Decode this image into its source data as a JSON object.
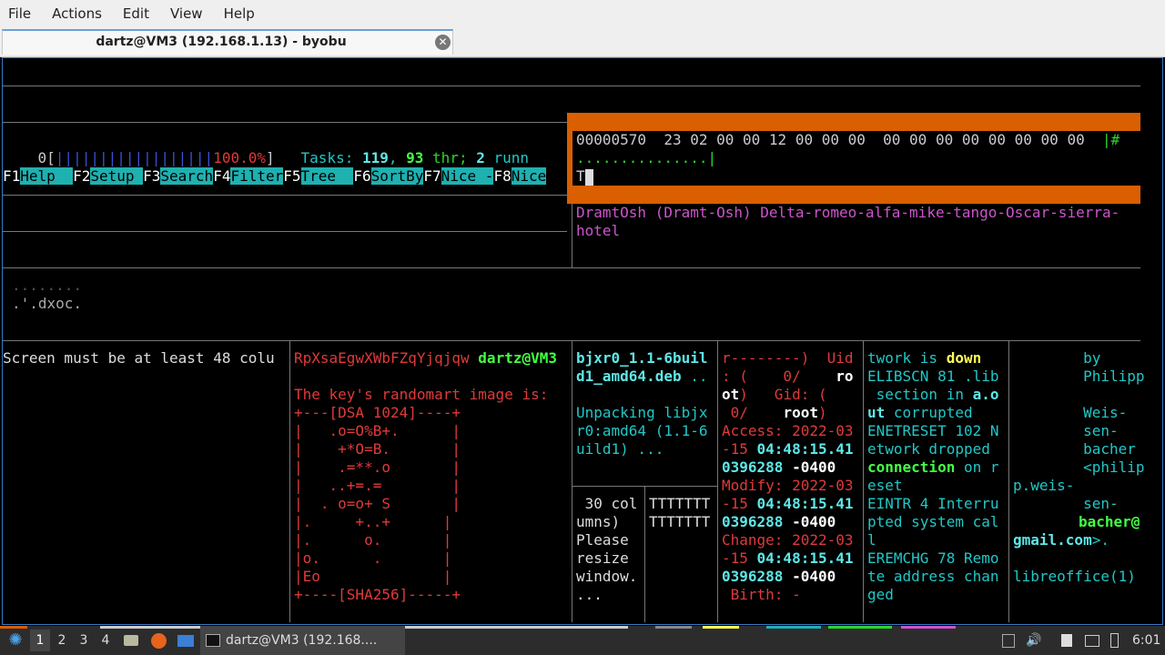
{
  "menubar": {
    "items": [
      "File",
      "Actions",
      "Edit",
      "View",
      "Help"
    ]
  },
  "tab": {
    "title": "dartz@VM3 (192.168.1.13) - byobu"
  },
  "htop": {
    "cpu_label": "0[",
    "cpu_bars": "||||||||||||||||||",
    "cpu_value": "100.0%",
    "cpu_close": "]",
    "tasks_label": "Tasks: ",
    "tasks_count": "119",
    "sep1": ", ",
    "threads_count": "93",
    "threads_label": " thr; ",
    "running_count": "2",
    "running_label": " runn",
    "fkeys": [
      {
        "key": "F1",
        "label": "Help  "
      },
      {
        "key": "F2",
        "label": "Setup "
      },
      {
        "key": "F3",
        "label": "Search"
      },
      {
        "key": "F4",
        "label": "Filter"
      },
      {
        "key": "F5",
        "label": "Tree  "
      },
      {
        "key": "F6",
        "label": "SortBy"
      },
      {
        "key": "F7",
        "label": "Nice -"
      },
      {
        "key": "F8",
        "label": "Nice"
      }
    ]
  },
  "hexdump": {
    "line1_offset": "00000570",
    "line1_bytes": "  23 02 00 00 12 00 00 00  00 00 00 00 00 00 00 00  ",
    "line1_ascii": "|#",
    "line2": "...............|",
    "line3": "T"
  },
  "nato": {
    "line1": "DramtOsh (Dramt-Osh) Delta-romeo-alfa-mike-tango-Oscar-sierra-",
    "line2": "hotel"
  },
  "small_pane": {
    "line1": "........",
    "line2": ".'.dxoc."
  },
  "screen_msg": "Screen must be at least 48 colu",
  "randomart": {
    "header_text": "RpXsaEgwXWbFZqYjqjqw",
    "prompt": "dartz@VM3",
    "title": "The key's randomart image is:",
    "lines": [
      "+---[DSA 1024]----+",
      "|   .o=O%B+.      |",
      "|    +*O=B.       |",
      "|    .=**.o       |",
      "|   ..+=.=        |",
      "|  . o=o+ S       |",
      "|.     +..+      |",
      "|.      o.       |",
      "|o.      .       |",
      "|Eo              |",
      "+----[SHA256]-----+"
    ]
  },
  "dpkg": {
    "line1": "bjxr0_1.1-6buil",
    "line2": "d1_amd64.deb",
    "line2_dots": " ..",
    "line3": "Unpacking libjx",
    "line4": "r0:amd64 (1.1-6",
    "line5": "uild1) ..."
  },
  "resize": {
    "lines": [
      " 30 col",
      "umns)",
      "Please",
      "resize",
      "window.",
      "..."
    ]
  },
  "tpane": {
    "lines": [
      "TTTTTTT",
      "TTTTTTT"
    ]
  },
  "stat": {
    "l1a": "r--------)",
    "l1b": "  Uid",
    "l2a": ": (    0/",
    "l2b": "    ro",
    "l3a": "ot",
    "l3b": ")   Gid: (",
    "l4a": " 0/",
    "l4b": "    root",
    "l4c": ")",
    "access_label": "Access: 2022-03",
    "access_time_a": "-15 ",
    "access_time_b": "04:48:15.41",
    "access_rest_a": "0396288",
    "access_rest_b": " -0400",
    "modify_label": "Modify: 2022-03",
    "modify_time_a": "-15 ",
    "modify_time_b": "04:48:15.41",
    "modify_rest_a": "0396288",
    "modify_rest_b": " -0400",
    "change_label": "Change: 2022-03",
    "change_time_a": "-15 ",
    "change_time_b": "04:48:15.41",
    "change_rest_a": "0396288",
    "change_rest_b": " -0400",
    "birth": " Birth: -"
  },
  "errno": {
    "l1a": "twork is ",
    "l1b": "down",
    "l2a": "ELIBSCN 81 .lib",
    "l3a": " section in ",
    "l3b": "a.o",
    "l4a": "ut",
    "l4b": " corrupted",
    "l5": "ENETRESET 102 N",
    "l6": "etwork dropped",
    "l7a": "connection",
    "l7b": " on r",
    "l8": "eset",
    "l9a": "EINTR 4",
    "l9b": " Interru",
    "l10": "pted system cal",
    "l11": "l",
    "l12a": "EREMCHG 78",
    "l12b": " Remo",
    "l13": "te address chan",
    "l14": "ged"
  },
  "manpage": {
    "l1": "        by",
    "l2": "        Philipp",
    "l3": "        Weis-",
    "l4": "        sen-",
    "l5": "        bacher",
    "l6": "        <philip",
    "l7": "p.weis-",
    "l8": "        sen-",
    "l9": "bacher@",
    "l10a": "gmail.com",
    "l10b": ">.",
    "l11": "libreoffice(1)"
  },
  "taskbar": {
    "workspaces": [
      "1",
      "2",
      "3",
      "4"
    ],
    "window_title": "dartz@VM3 (192.168....",
    "clock": "6:01"
  },
  "colors": {
    "orange": "#d95f00",
    "teal": "#1fb0b0",
    "terminal_border": "#3a78c4"
  }
}
